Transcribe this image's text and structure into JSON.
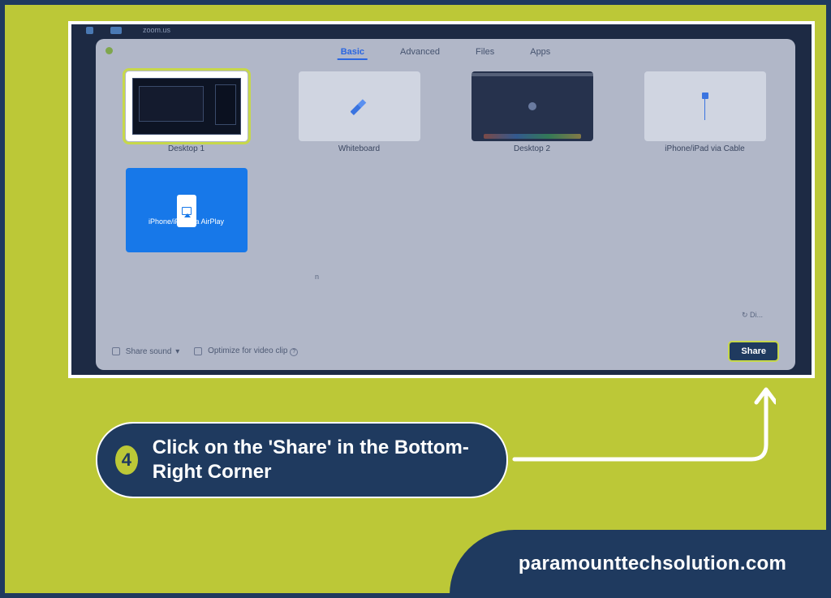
{
  "tabs": {
    "basic": "Basic",
    "advanced": "Advanced",
    "files": "Files",
    "apps": "Apps"
  },
  "sources": {
    "desktop1": "Desktop 1",
    "whiteboard": "Whiteboard",
    "desktop2": "Desktop 2",
    "iphone_cable": "iPhone/iPad via Cable",
    "airplay": "iPhone/iPad via AirPlay"
  },
  "footer": {
    "share_sound": "Share sound",
    "optimize": "Optimize for video clip",
    "share": "Share"
  },
  "misc": {
    "topbar": "zoom.us",
    "lone_n": "n",
    "bottom_hint": "↻ Di..."
  },
  "callout": {
    "step": "4",
    "text": "Click on the 'Share' in the Bottom-Right Corner"
  },
  "brand": "paramounttechsolution.com"
}
